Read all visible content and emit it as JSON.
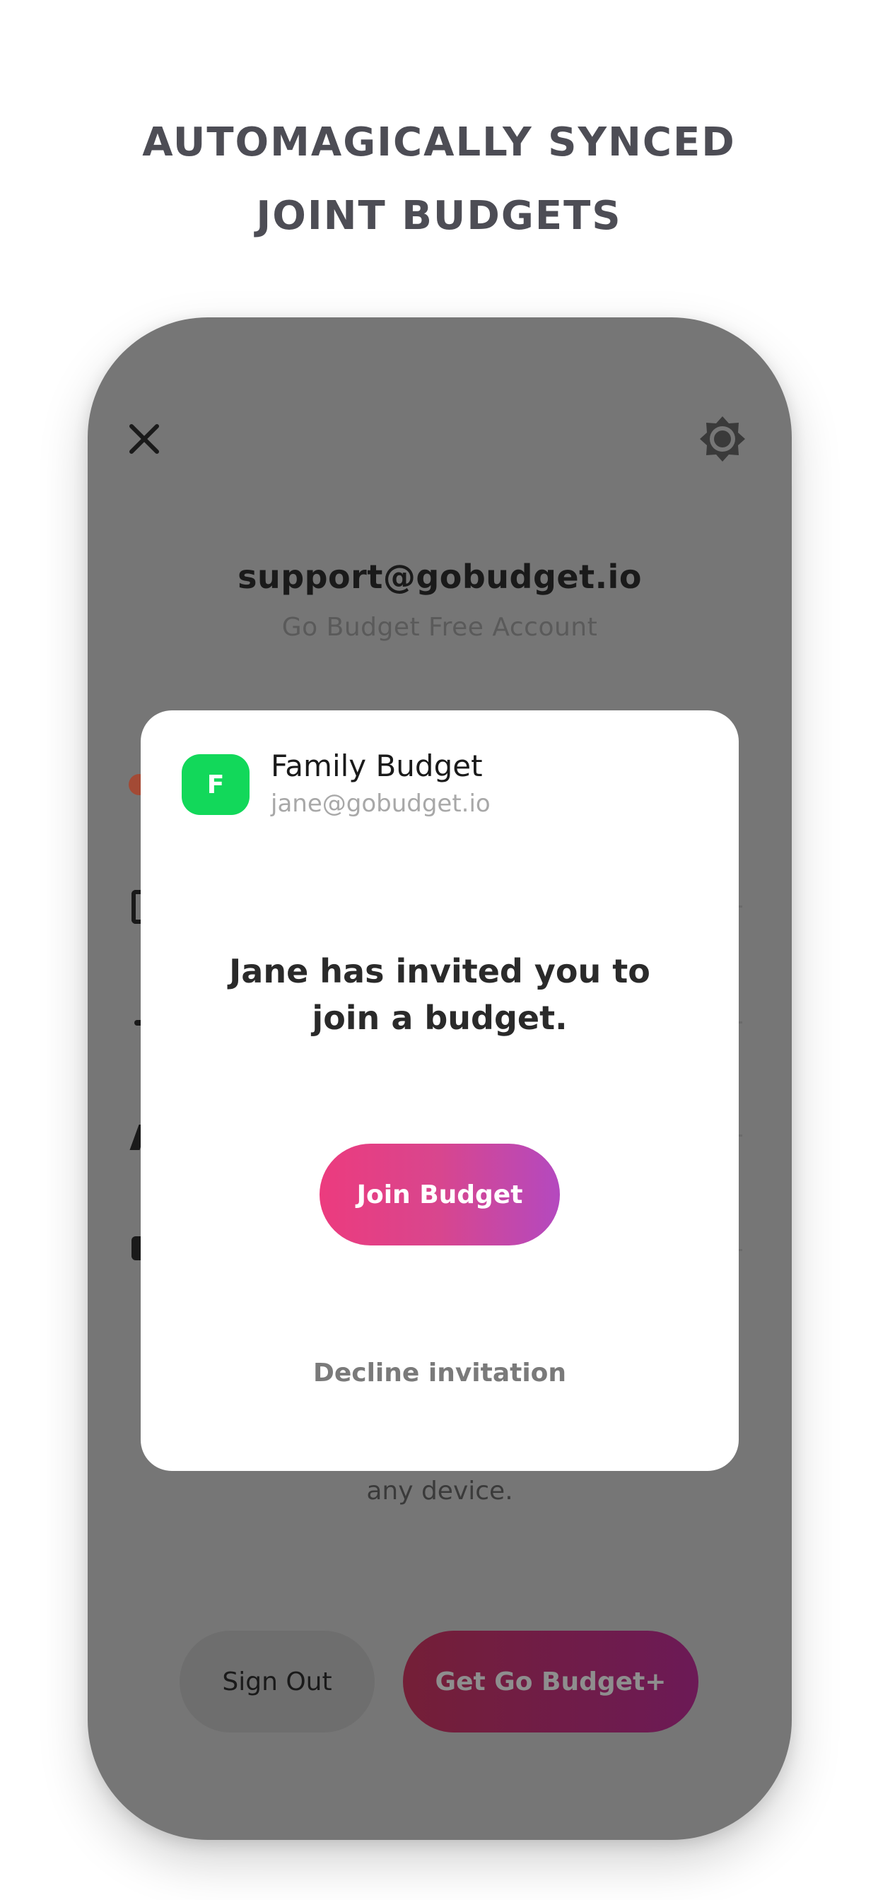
{
  "headline": {
    "line1": "AUTOMAGICALLY SYNCED",
    "line2": "JOINT BUDGETS"
  },
  "screen": {
    "account_email": "support@gobudget.io",
    "account_plan": "Go Budget Free Account",
    "device_note": "any device.",
    "sign_out_label": "Sign Out",
    "upgrade_label": "Get Go Budget+",
    "icons": [
      "close-icon",
      "gear-icon"
    ]
  },
  "modal": {
    "avatar_letter": "F",
    "budget_name": "Family Budget",
    "owner_email": "jane@gobudget.io",
    "message_line1": "Jane has invited you to",
    "message_line2": "join a budget.",
    "join_label": "Join Budget",
    "decline_label": "Decline invitation"
  },
  "colors": {
    "avatar": "#12d85a",
    "join_gradient_start": "#ec3b7e",
    "join_gradient_end": "#b449bf",
    "overlay_background": "#767676"
  }
}
